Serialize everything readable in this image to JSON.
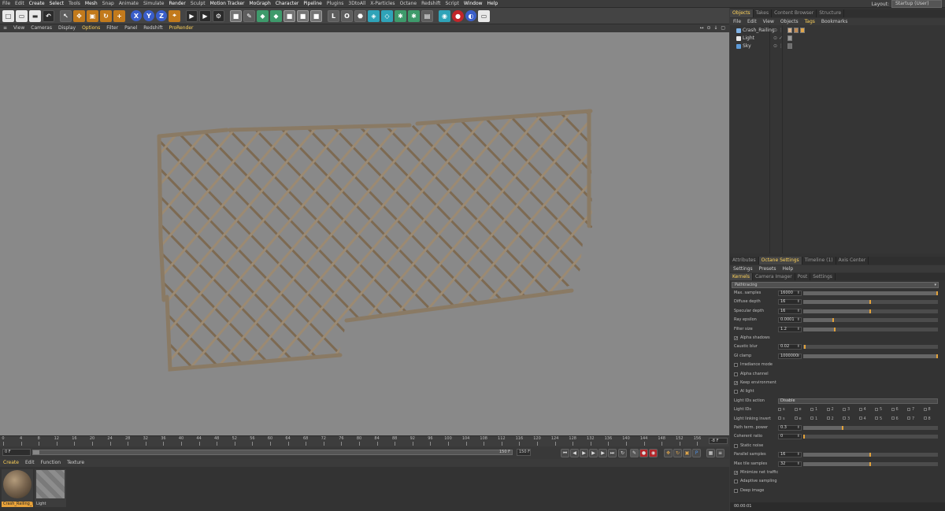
{
  "menubar": {
    "items": [
      "File",
      "Edit",
      "Create",
      "Select",
      "Tools",
      "Mesh",
      "Snap",
      "Animate",
      "Simulate",
      "Render",
      "Sculpt",
      "Motion Tracker",
      "MoGraph",
      "Character",
      "Pipeline",
      "Plugins",
      "3DtoAll",
      "X-Particles",
      "Octane",
      "Redshift",
      "Script",
      "Window",
      "Help"
    ],
    "layout_label": "Layout:",
    "layout_value": "Startup (User)"
  },
  "toolbar": {
    "icons": [
      "new-scene-icon",
      "open-icon",
      "save-icon",
      "undo-icon",
      "live-selection-icon",
      "move-icon",
      "scale-icon",
      "rotate-icon",
      "add-icon",
      "x-axis-icon",
      "y-axis-icon",
      "z-axis-icon",
      "world-coordinates-icon",
      "render-view-icon",
      "render-picture-viewer-icon",
      "edit-render-settings-icon",
      "cube-icon",
      "spline-pen-icon",
      "nurbs-icon",
      "array-icon",
      "deformer-icon",
      "floor-icon",
      "camera-icon",
      "light-icon",
      "octane-icon",
      "octane-live-viewer-icon",
      "redshift-icon",
      "octane-light-icon",
      "octane-material-icon",
      "octane-camera-icon",
      "x-particles-icon",
      "teal-material-icon",
      "render-icon",
      "layout-icon",
      "monitor-icon"
    ]
  },
  "viewport_menu": {
    "items": [
      "View",
      "Cameras",
      "Display",
      "Options",
      "Filter",
      "Panel",
      "Redshift",
      "ProRender"
    ],
    "icons_text": "↔ ⊙ ↓ ▢"
  },
  "timeline": {
    "ticks": [
      "0",
      "4",
      "8",
      "12",
      "16",
      "20",
      "24",
      "28",
      "32",
      "36",
      "40",
      "44",
      "48",
      "52",
      "56",
      "60",
      "64",
      "68",
      "72",
      "76",
      "80",
      "84",
      "88",
      "92",
      "96",
      "100",
      "104",
      "108",
      "112",
      "116",
      "120",
      "124",
      "128",
      "132",
      "136",
      "140",
      "144",
      "148",
      "152",
      "156"
    ],
    "frame_field": "-8 F",
    "start_field": "0 F",
    "slider_start": "0 F",
    "slider_end": "150 F",
    "end_field": "150 F"
  },
  "material_manager": {
    "menu": [
      "Create",
      "Edit",
      "Function",
      "Texture"
    ],
    "materials": [
      {
        "name": "Crash_Railing_Tx",
        "selected": true
      },
      {
        "name": "Light",
        "selected": false
      }
    ]
  },
  "object_manager": {
    "tabs": [
      "Objects",
      "Takes",
      "Content Browser",
      "Structure"
    ],
    "active_tab": 0,
    "menu": [
      "File",
      "Edit",
      "View",
      "Objects",
      "Tags",
      "Bookmarks"
    ],
    "objects": [
      {
        "name": "Crash_Railing",
        "icon_color": "#7fb2e6",
        "flags": "⊙ ⋮"
      },
      {
        "name": "Light",
        "icon_color": "#e8e8e8",
        "flags": "⊙ ✓"
      },
      {
        "name": "Sky",
        "icon_color": "#5c9ad8",
        "flags": "⊙ ⋮"
      }
    ]
  },
  "attribute_manager": {
    "tabs": [
      "Attributes",
      "Octane Settings",
      "Timeline (1)",
      "Axis Center"
    ],
    "active_tab": 1,
    "menu": [
      "Settings",
      "Presets",
      "Help"
    ],
    "subtabs": [
      "Kernels",
      "Camera Imager",
      "Post",
      "Settings"
    ],
    "active_subtab": 0,
    "kernel": "Pathtracing",
    "params": [
      {
        "type": "num",
        "label": "Max. samples",
        "value": "16000",
        "fill": 1.0
      },
      {
        "type": "num",
        "label": "Diffuse depth",
        "value": "16",
        "fill": 0.5
      },
      {
        "type": "num",
        "label": "Specular depth",
        "value": "16",
        "fill": 0.5
      },
      {
        "type": "num",
        "label": "Ray epsilon",
        "value": "0.0001",
        "fill": 0.23
      },
      {
        "type": "num",
        "label": "Filter size",
        "value": "1.2",
        "fill": 0.24
      },
      {
        "type": "check",
        "label": "Alpha shadows",
        "checked": true
      },
      {
        "type": "num",
        "label": "Caustic blur",
        "value": "0.02",
        "fill": 0.02
      },
      {
        "type": "num",
        "label": "GI clamp",
        "value": "1000000",
        "fill": 1.0
      },
      {
        "type": "check",
        "label": "Irradiance mode",
        "checked": false
      },
      {
        "type": "check",
        "label": "Alpha channel",
        "checked": false
      },
      {
        "type": "check",
        "label": "Keep environment",
        "checked": true
      },
      {
        "type": "check",
        "label": "AI light",
        "checked": false
      },
      {
        "type": "select",
        "label": "Light IDs action",
        "value": "Disable"
      },
      {
        "type": "ids",
        "label": "Light IDs",
        "ids": [
          "s",
          "e",
          "1",
          "2",
          "3",
          "4",
          "5",
          "6",
          "7",
          "8"
        ]
      },
      {
        "type": "ids",
        "label": "Light linking invert",
        "ids": [
          "s",
          "e",
          "1",
          "2",
          "3",
          "4",
          "5",
          "6",
          "7",
          "8"
        ]
      },
      {
        "type": "num",
        "label": "Path term. power",
        "value": "0.3",
        "fill": 0.3
      },
      {
        "type": "num",
        "label": "Coherent ratio",
        "value": "0",
        "fill": 0.0
      },
      {
        "type": "check",
        "label": "Static noise",
        "checked": false
      },
      {
        "type": "num",
        "label": "Parallel samples",
        "value": "16",
        "fill": 0.5
      },
      {
        "type": "num",
        "label": "Max tile samples",
        "value": "32",
        "fill": 0.5
      },
      {
        "type": "check",
        "label": "Minimize net traffic",
        "checked": true
      },
      {
        "type": "check",
        "label": "Adaptive sampling",
        "checked": false
      },
      {
        "type": "check",
        "label": "Deep image",
        "checked": false
      }
    ]
  },
  "status": {
    "text": "00:00:01"
  }
}
